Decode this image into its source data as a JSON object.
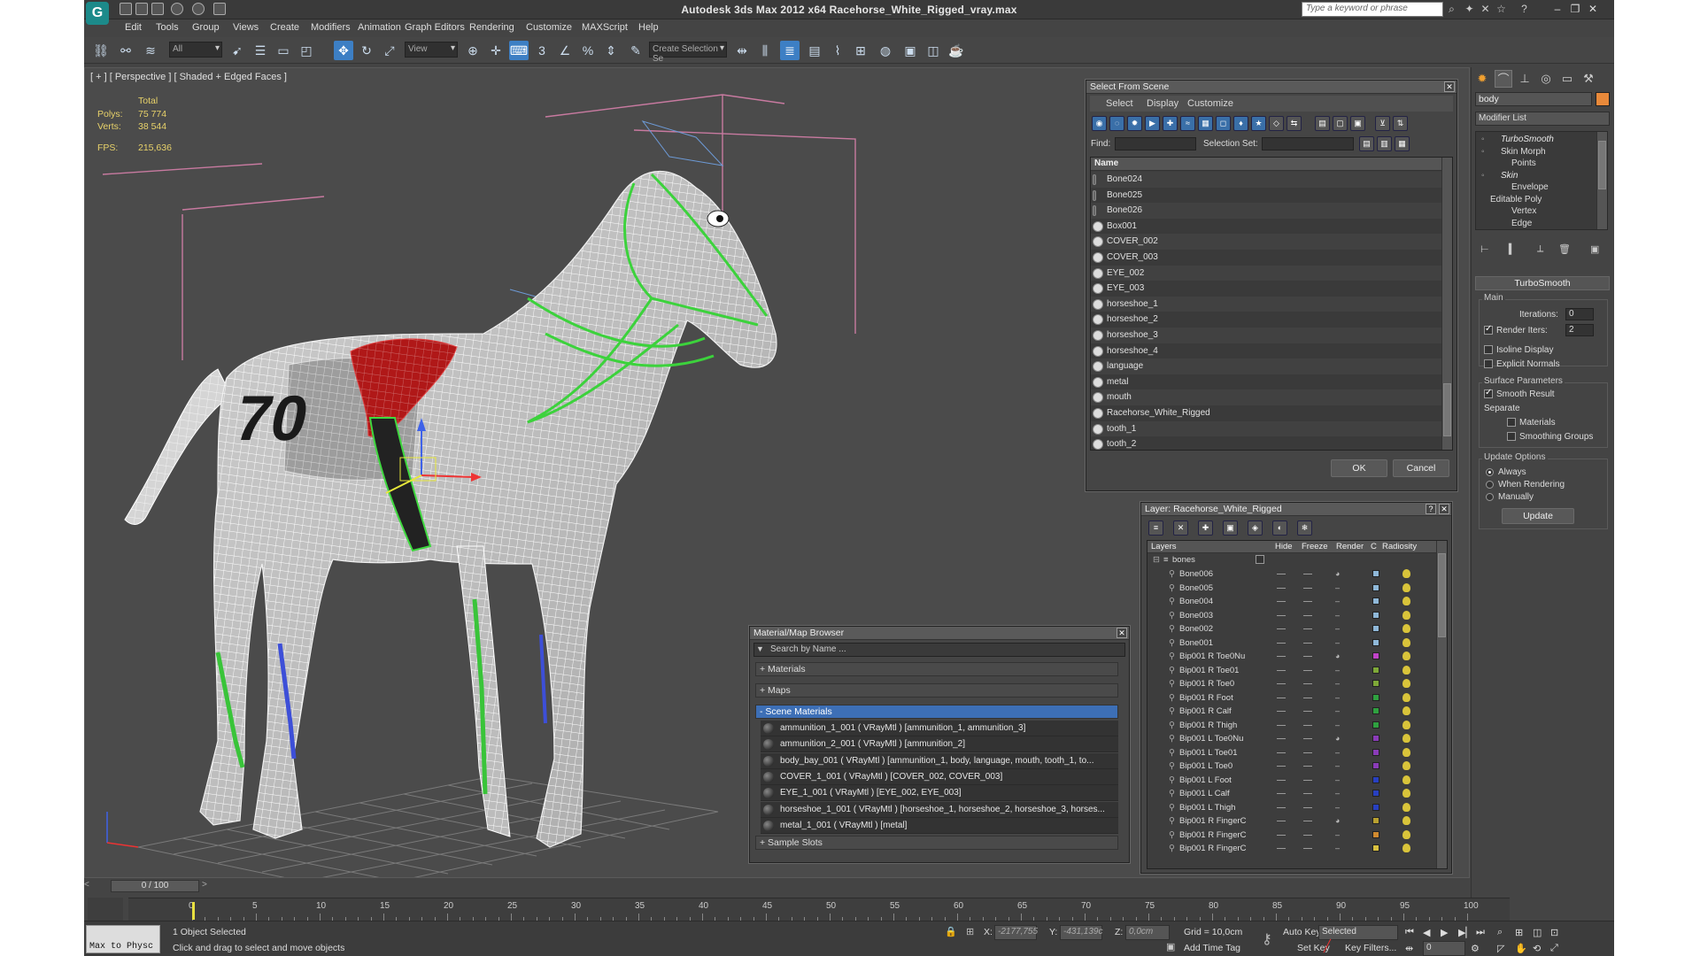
{
  "window": {
    "title": "Autodesk 3ds Max  2012 x64     Racehorse_White_Rigged_vray.max",
    "search_placeholder": "Type a keyword or phrase",
    "app_logo": "G"
  },
  "menu": [
    "Edit",
    "Tools",
    "Group",
    "Views",
    "Create",
    "Modifiers",
    "Animation",
    "Graph Editors",
    "Rendering",
    "Customize",
    "MAXScript",
    "Help"
  ],
  "toolbar": {
    "selection_filter": "All",
    "ref_coord": "View",
    "named_selection": "Create Selection Se",
    "snap_label": "3"
  },
  "viewport": {
    "label": "[ + ] [ Perspective ] [ Shaded + Edged Faces ]",
    "stats_header": "Total",
    "polys_label": "Polys:",
    "polys_value": "75 774",
    "verts_label": "Verts:",
    "verts_value": "38 544",
    "fps_label": "FPS:",
    "fps_value": "215,636"
  },
  "select_from_scene": {
    "title": "Select From Scene",
    "tabs": [
      "Select",
      "Display",
      "Customize"
    ],
    "find_label": "Find:",
    "selection_set_label": "Selection Set:",
    "column_name": "Name",
    "items": [
      "Bone024",
      "Bone025",
      "Bone026",
      "Box001",
      "COVER_002",
      "COVER_003",
      "EYE_002",
      "EYE_003",
      "horseshoe_1",
      "horseshoe_2",
      "horseshoe_3",
      "horseshoe_4",
      "language",
      "metal",
      "mouth",
      "Racehorse_White_Rigged",
      "tooth_1",
      "tooth_2"
    ],
    "ok": "OK",
    "cancel": "Cancel"
  },
  "layer_dialog": {
    "title": "Layer: Racehorse_White_Rigged",
    "help": "?",
    "columns": [
      "Layers",
      "Hide",
      "Freeze",
      "Render",
      "C",
      "Radiosity"
    ],
    "root": "bones",
    "rows": [
      {
        "name": "Bone006",
        "color": "#8fb8d8"
      },
      {
        "name": "Bone005",
        "color": "#8fb8d8"
      },
      {
        "name": "Bone004",
        "color": "#8fb8d8"
      },
      {
        "name": "Bone003",
        "color": "#8fb8d8"
      },
      {
        "name": "Bone002",
        "color": "#8fb8d8"
      },
      {
        "name": "Bone001",
        "color": "#8fb8d8"
      },
      {
        "name": "Bip001 R Toe0Nu",
        "color": "#c043c8"
      },
      {
        "name": "Bip001 R Toe01",
        "color": "#7ea838"
      },
      {
        "name": "Bip001 R Toe0",
        "color": "#7ea838"
      },
      {
        "name": "Bip001 R Foot",
        "color": "#2fa040"
      },
      {
        "name": "Bip001 R Calf",
        "color": "#2fa040"
      },
      {
        "name": "Bip001 R Thigh",
        "color": "#2fa040"
      },
      {
        "name": "Bip001 L Toe0Nu",
        "color": "#8a3cb8"
      },
      {
        "name": "Bip001 L Toe01",
        "color": "#8a3cb8"
      },
      {
        "name": "Bip001 L Toe0",
        "color": "#8a3cb8"
      },
      {
        "name": "Bip001 L Foot",
        "color": "#2840c0"
      },
      {
        "name": "Bip001 L Calf",
        "color": "#2840c0"
      },
      {
        "name": "Bip001 L Thigh",
        "color": "#2840c0"
      },
      {
        "name": "Bip001 R FingerC",
        "color": "#b8a030"
      },
      {
        "name": "Bip001 R FingerC",
        "color": "#d08a30"
      },
      {
        "name": "Bip001 R FingerC",
        "color": "#d8c040"
      }
    ]
  },
  "material_browser": {
    "title": "Material/Map Browser",
    "search_placeholder": "Search by Name ...",
    "sections": [
      "+ Materials",
      "+ Maps",
      "- Scene Materials"
    ],
    "materials": [
      "ammunition_1_001  ( VRayMtl )  [ammunition_1, ammunition_3]",
      "ammunition_2_001  ( VRayMtl )  [ammunition_2]",
      "body_bay_001  ( VRayMtl )  [ammunition_1, body, language, mouth, tooth_1, to...",
      "COVER_1_001  ( VRayMtl )  [COVER_002, COVER_003]",
      "EYE_1_001  ( VRayMtl )  [EYE_002, EYE_003]",
      "horseshoe_1_001  ( VRayMtl )  [horseshoe_1, horseshoe_2, horseshoe_3, horses...",
      "metal_1_001  ( VRayMtl )  [metal]"
    ],
    "sample_slots": "+ Sample Slots"
  },
  "command_panel": {
    "object_name": "body",
    "object_color": "#e8893a",
    "modifier_list": "Modifier List",
    "stack": [
      {
        "label": "TurboSmooth",
        "indent": 2,
        "italic": true
      },
      {
        "label": "Skin Morph",
        "indent": 2,
        "italic": false
      },
      {
        "label": "Points",
        "indent": 3,
        "italic": false
      },
      {
        "label": "Skin",
        "indent": 2,
        "italic": true
      },
      {
        "label": "Envelope",
        "indent": 3,
        "italic": false
      },
      {
        "label": "Editable Poly",
        "indent": 1,
        "italic": false
      },
      {
        "label": "Vertex",
        "indent": 3,
        "italic": false
      },
      {
        "label": "Edge",
        "indent": 3,
        "italic": false
      }
    ],
    "rollout_title": "TurboSmooth",
    "main_group": "Main",
    "iterations_label": "Iterations:",
    "iterations_value": "0",
    "render_iters_label": "Render Iters:",
    "render_iters_value": "2",
    "isoline_label": "Isoline Display",
    "explicit_normals_label": "Explicit Normals",
    "surface_params": "Surface Parameters",
    "smooth_result": "Smooth Result",
    "separate": "Separate",
    "materials_label": "Materials",
    "smoothing_groups_label": "Smoothing Groups",
    "update_options": "Update Options",
    "always": "Always",
    "when_rendering": "When Rendering",
    "manually": "Manually",
    "update_button": "Update"
  },
  "timeline": {
    "slider_label": "0 / 100",
    "ticks": [
      "0",
      "5",
      "10",
      "15",
      "20",
      "25",
      "30",
      "35",
      "40",
      "45",
      "50",
      "55",
      "60",
      "65",
      "70",
      "75",
      "80",
      "85",
      "90",
      "95",
      "100"
    ]
  },
  "status": {
    "maxscript": "Max to Physc",
    "selected_count": "1 Object Selected",
    "prompt": "Click and drag to select and move objects",
    "x_label": "X:",
    "x_value": "-2177,755",
    "y_label": "Y:",
    "y_value": "-431,139c",
    "z_label": "Z:",
    "z_value": "0,0cm",
    "grid": "Grid = 10,0cm",
    "add_time_tag": "Add Time Tag",
    "auto_key": "Auto Key",
    "selected_dd": "Selected",
    "set_key": "Set Key",
    "key_filters": "Key Filters...",
    "frame": "0"
  }
}
